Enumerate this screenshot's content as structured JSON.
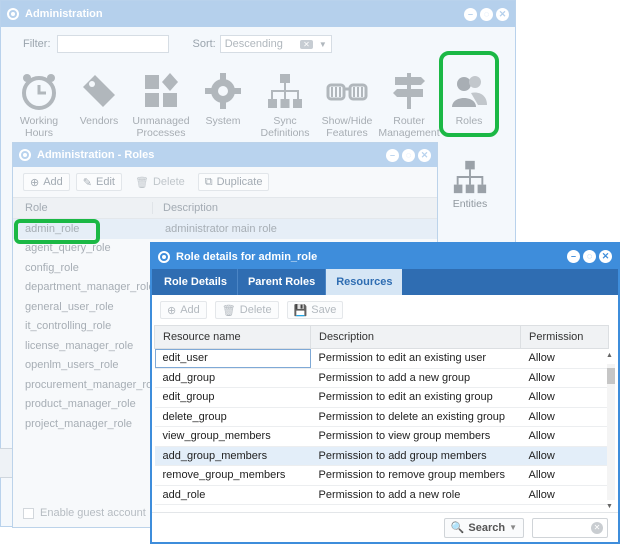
{
  "admin": {
    "title": "Administration",
    "filter_label": "Filter:",
    "filter_value": "",
    "sort_label": "Sort:",
    "sort_value": "Descending",
    "tiles": [
      {
        "label": "Working\nHours",
        "icon": "clock-icon"
      },
      {
        "label": "Vendors",
        "icon": "tag-icon"
      },
      {
        "label": "Unmanaged\nProcesses",
        "icon": "blocks-icon"
      },
      {
        "label": "System",
        "icon": "gear-icon"
      },
      {
        "label": "Sync\nDefinitions",
        "icon": "hierarchy-icon"
      },
      {
        "label": "Show/Hide\nFeatures",
        "icon": "glasses-icon"
      },
      {
        "label": "Router\nManagement",
        "icon": "signpost-icon"
      },
      {
        "label": "Roles",
        "icon": "users-icon"
      }
    ],
    "entities_label": "Entities"
  },
  "roles_window": {
    "title": "Administration - Roles",
    "toolbar": {
      "add": "Add",
      "edit": "Edit",
      "delete": "Delete",
      "duplicate": "Duplicate"
    },
    "columns": {
      "role": "Role",
      "description": "Description"
    },
    "rows": [
      {
        "role": "admin_role",
        "description": "administrator main role"
      },
      {
        "role": "agent_query_role",
        "description": ""
      },
      {
        "role": "config_role",
        "description": ""
      },
      {
        "role": "department_manager_role",
        "description": ""
      },
      {
        "role": "general_user_role",
        "description": ""
      },
      {
        "role": "it_controlling_role",
        "description": ""
      },
      {
        "role": "license_manager_role",
        "description": ""
      },
      {
        "role": "openlm_users_role",
        "description": ""
      },
      {
        "role": "procurement_manager_role",
        "description": ""
      },
      {
        "role": "product_manager_role",
        "description": ""
      },
      {
        "role": "project_manager_role",
        "description": ""
      }
    ],
    "guest_label": "Enable guest account"
  },
  "details_window": {
    "title": "Role details for admin_role",
    "tabs": [
      "Role Details",
      "Parent Roles",
      "Resources"
    ],
    "active_tab": "Resources",
    "toolbar": {
      "add": "Add",
      "delete": "Delete",
      "save": "Save"
    },
    "columns": {
      "resource": "Resource name",
      "description": "Description",
      "permission": "Permission"
    },
    "rows": [
      {
        "resource": "edit_user",
        "description": "Permission to edit an existing user",
        "permission": "Allow"
      },
      {
        "resource": "add_group",
        "description": "Permission to add a new group",
        "permission": "Allow"
      },
      {
        "resource": "edit_group",
        "description": "Permission to edit an existing group",
        "permission": "Allow"
      },
      {
        "resource": "delete_group",
        "description": "Permission to delete an existing group",
        "permission": "Allow"
      },
      {
        "resource": "view_group_members",
        "description": "Permission to view group members",
        "permission": "Allow"
      },
      {
        "resource": "add_group_members",
        "description": "Permission to add group members",
        "permission": "Allow"
      },
      {
        "resource": "remove_group_members",
        "description": "Permission to remove group members",
        "permission": "Allow"
      },
      {
        "resource": "add_role",
        "description": "Permission to add a new role",
        "permission": "Allow"
      }
    ],
    "search_label": "Search",
    "search_value": ""
  },
  "colors": {
    "accent": "#3e8ddb",
    "tab_bar": "#2f6db2",
    "highlight": "#1bb845"
  }
}
